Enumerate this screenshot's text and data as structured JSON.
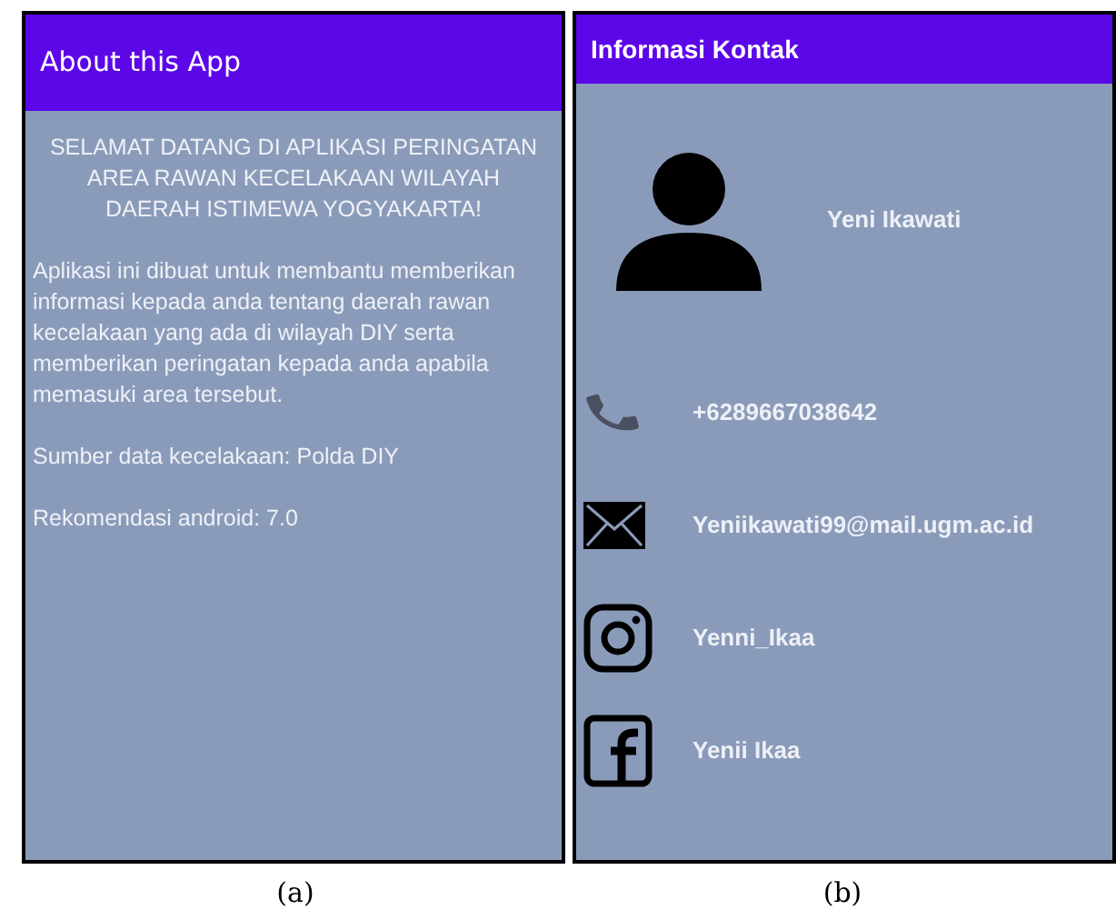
{
  "screens": [
    {
      "kind": "about",
      "title": "About this App",
      "heading": "SELAMAT DATANG DI APLIKASI PERINGATAN AREA RAWAN KECELAKAAN WILAYAH DAERAH ISTIMEWA YOGYAKARTA!",
      "paragraphs": [
        "Aplikasi ini dibuat untuk membantu memberikan informasi kepada anda tentang daerah rawan kecelakaan yang ada di wilayah DIY serta memberikan peringatan kepada anda apabila memasuki area tersebut.",
        "Sumber data kecelakaan: Polda DIY",
        "Rekomendasi android: 7.0"
      ],
      "caption": "(a)"
    },
    {
      "kind": "contact",
      "title": "Informasi Kontak",
      "contacts": [
        {
          "kind": "person",
          "text": "Yeni Ikawati"
        },
        {
          "kind": "phone",
          "text": "+6289667038642"
        },
        {
          "kind": "email",
          "text": "Yeniikawati99@mail.ugm.ac.id"
        },
        {
          "kind": "instagram",
          "text": "Yenni_Ikaa"
        },
        {
          "kind": "facebook",
          "text": "Yenii Ikaa"
        }
      ],
      "caption": "(b)"
    }
  ]
}
